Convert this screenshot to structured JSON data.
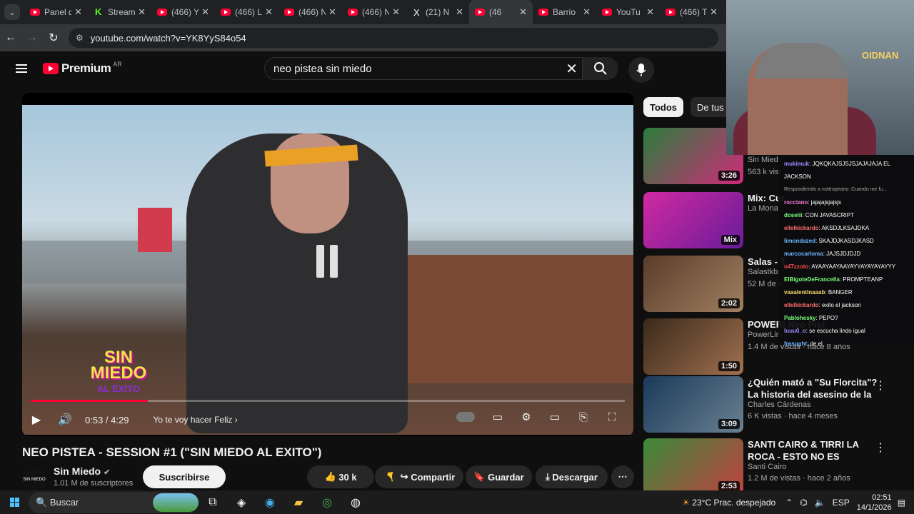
{
  "tabs": [
    {
      "title": "Panel d",
      "icon": "youtube-icon"
    },
    {
      "title": "Stream",
      "icon": "kick-icon"
    },
    {
      "title": "(466) Y",
      "icon": "youtube-icon"
    },
    {
      "title": "(466) L",
      "icon": "youtube-icon"
    },
    {
      "title": "(466) N",
      "icon": "youtube-icon"
    },
    {
      "title": "(466) N",
      "icon": "youtube-icon"
    },
    {
      "title": "(21) N",
      "icon": "x-icon"
    },
    {
      "title": "(46",
      "icon": "youtube-icon"
    },
    {
      "title": "Barrio",
      "icon": "youtube-icon"
    },
    {
      "title": "YouTu",
      "icon": "youtube-icon"
    },
    {
      "title": "(466) T",
      "icon": "youtube-icon"
    }
  ],
  "address": {
    "url": "youtube.com/watch?v=YK8YyS84o54"
  },
  "header": {
    "logo": "Premium",
    "country": "AR",
    "search_query": "neo pistea sin miedo"
  },
  "player": {
    "time": "0:53 / 4:29",
    "chapter": "Yo te voy hacer Feliz",
    "progress": 0.197,
    "overlay_brand_line1": "SIN",
    "overlay_brand_line2": "MIEDO",
    "overlay_brand_line3": "AL ÉXITO"
  },
  "video": {
    "title": "NEO PISTEA - SESSION #1 (\"SIN MIEDO AL EXITO\")",
    "channel": "Sin Miedo",
    "avatar_text": "SIN MIEDO",
    "subscribers": "1.01 M de suscriptores",
    "subscribe": "Suscribirse",
    "likes": "30 k",
    "share": "Compartir",
    "save": "Guardar",
    "download": "Descargar"
  },
  "chips": [
    "Todos",
    "De tus bú"
  ],
  "recommendations": [
    {
      "title": "",
      "channel": "Sin Miedo",
      "meta": "563 k vist",
      "duration": "3:26"
    },
    {
      "title": "Mix: Cur",
      "channel": "La Mona",
      "meta": "",
      "duration": "Mix"
    },
    {
      "title": "Salas - T",
      "channel": "Salastkbr",
      "meta": "52 M de v",
      "duration": "2:02"
    },
    {
      "title": "POWERI Neo Pist",
      "channel": "PowerLin",
      "meta": "1.4 M de vistas · hace 8 años",
      "duration": "1:50"
    },
    {
      "title": "¿Quién mató a \"Su Florcita\"? La historia del asesino de la ...",
      "channel": "Charles Cárdenas",
      "meta": "6 K vistas · hace 4 meses",
      "duration": "3:09"
    },
    {
      "title": "SANTI CAIRO & TIRRI LA ROCA - ESTO NO ES CUMBIA CHETA",
      "channel": "Santi Cairo",
      "meta": "1.2 M de vistas · hace 2 años",
      "duration": "2:53"
    }
  ],
  "stream_overlay": {
    "neon_text": "OIDNAN"
  },
  "chat": [
    {
      "user": "mukimuk",
      "color": "#9b8cff",
      "text": ": JQKQKAJSJSJSJAJAJAJA EL"
    },
    {
      "user": "",
      "color": "#fff",
      "text": "JACKSON"
    },
    {
      "user": "",
      "color": "#aaa",
      "text": "Respondiendo a nottropeano: Cuando me fu..."
    },
    {
      "user": "rocciano",
      "color": "#ff7ad9",
      "text": ": jajajajsjajsjs"
    },
    {
      "user": "doseiii",
      "color": "#7cff7c",
      "text": ": CON JAVASCRIPT"
    },
    {
      "user": "ellelkickardo",
      "color": "#ff6b6b",
      "text": ": AKSDJLKSAJDKA"
    },
    {
      "user": "limondazed",
      "color": "#6bb8ff",
      "text": ": SKAJDJKASDJKASD"
    },
    {
      "user": "marcocarloma",
      "color": "#6bb8ff",
      "text": ": JAJSJDJDJD"
    },
    {
      "user": "n47zzoto",
      "color": "#ff4d4d",
      "text": ": AYAAYAAYAAYAYYAYAYAYAYYY"
    },
    {
      "user": "ElBigoteDeFrancella",
      "color": "#7cff7c",
      "text": ": PROMPTEANP"
    },
    {
      "user": "vaaalentinaaab",
      "color": "#ffd86b",
      "text": ": BANGER"
    },
    {
      "user": "ellelkickardo",
      "color": "#ff6b6b",
      "text": ": exito el jackson"
    },
    {
      "user": "Pablohesky",
      "color": "#7cff7c",
      "text": ": PEPO?"
    },
    {
      "user": "luuu0_o",
      "color": "#9b8cff",
      "text": ": se escucha lindo igual"
    },
    {
      "user": "fresught",
      "color": "#6bb8ff",
      "text": ": de el"
    }
  ],
  "taskbar": {
    "search": "Buscar",
    "weather": "23°C  Prac. despejado",
    "lang": "ESP",
    "time": "02:51",
    "date": "14/1/2026"
  }
}
